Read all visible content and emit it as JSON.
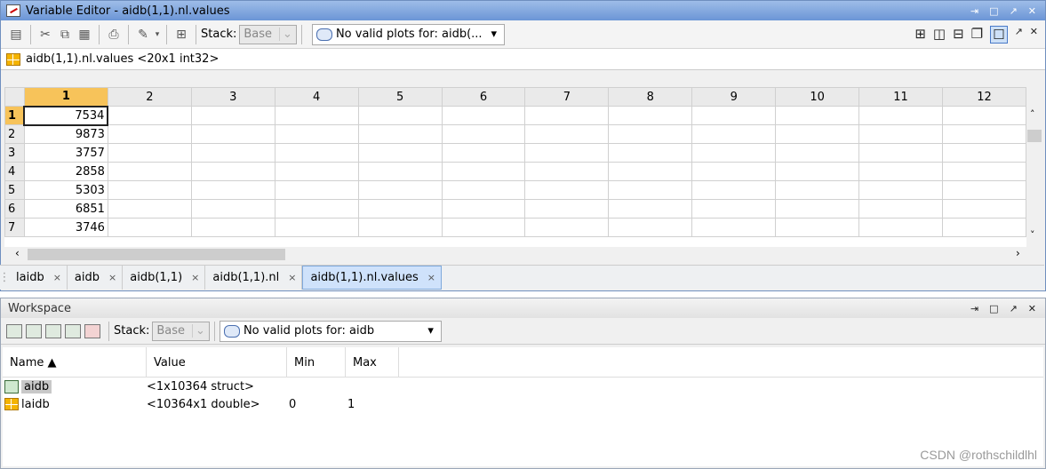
{
  "editor": {
    "title": "Variable Editor - aidb(1,1).nl.values",
    "win_buttons": [
      "⇥",
      "□",
      "↗",
      "✕"
    ],
    "stack_label": "Stack:",
    "stack_value": "Base",
    "plot_label": "No valid plots for: aidb(...",
    "variable_line": "aidb(1,1).nl.values <20x1 int32>",
    "columns": [
      "1",
      "2",
      "3",
      "4",
      "5",
      "6",
      "7",
      "8",
      "9",
      "10",
      "11",
      "12"
    ],
    "rows": [
      {
        "r": "1",
        "v": "7534"
      },
      {
        "r": "2",
        "v": "9873"
      },
      {
        "r": "3",
        "v": "3757"
      },
      {
        "r": "4",
        "v": "2858"
      },
      {
        "r": "5",
        "v": "5303"
      },
      {
        "r": "6",
        "v": "6851"
      },
      {
        "r": "7",
        "v": "3746"
      }
    ],
    "tabs": [
      {
        "label": "laidb",
        "active": false
      },
      {
        "label": "aidb",
        "active": false
      },
      {
        "label": "aidb(1,1)",
        "active": false
      },
      {
        "label": "aidb(1,1).nl",
        "active": false
      },
      {
        "label": "aidb(1,1).nl.values",
        "active": true
      }
    ]
  },
  "workspace": {
    "title": "Workspace",
    "stack_label": "Stack:",
    "stack_value": "Base",
    "plot_label": "No valid plots for: aidb",
    "headers": {
      "name": "Name ▲",
      "value": "Value",
      "min": "Min",
      "max": "Max"
    },
    "vars": [
      {
        "name": "aidb",
        "value": "<1x10364 struct>",
        "min": "",
        "max": ""
      },
      {
        "name": "laidb",
        "value": "<10364x1 double>",
        "min": "0",
        "max": "1"
      }
    ]
  },
  "watermark": "CSDN @rothschildlhl"
}
